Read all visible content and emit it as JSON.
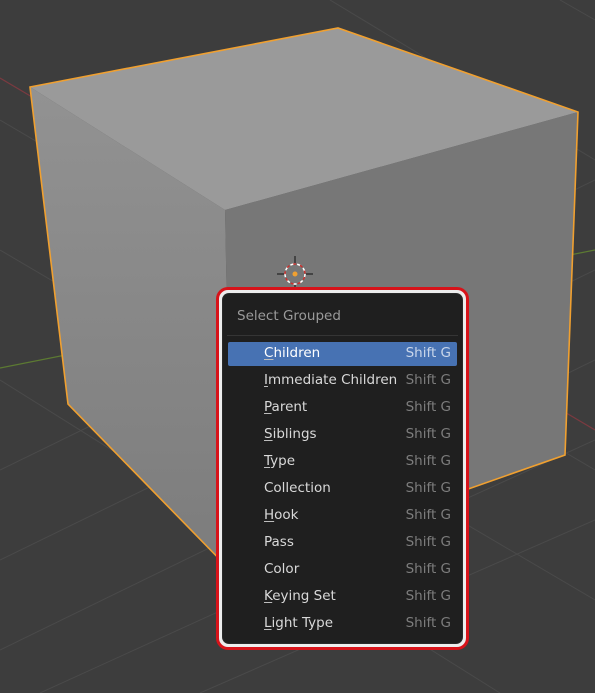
{
  "menu": {
    "title": "Select Grouped",
    "items": [
      {
        "first": "C",
        "rest": "hildren",
        "shortcut": "Shift G",
        "active": true
      },
      {
        "first": "I",
        "rest": "mmediate Children",
        "shortcut": "Shift G",
        "active": false
      },
      {
        "first": "P",
        "rest": "arent",
        "shortcut": "Shift G",
        "active": false
      },
      {
        "first": "S",
        "rest": "iblings",
        "shortcut": "Shift G",
        "active": false
      },
      {
        "first": "T",
        "rest": "ype",
        "shortcut": "Shift G",
        "active": false
      },
      {
        "first": "",
        "rest": "Collection",
        "shortcut": "Shift G",
        "active": false
      },
      {
        "first": "H",
        "rest": "ook",
        "shortcut": "Shift G",
        "active": false
      },
      {
        "first": "",
        "rest": "Pass",
        "shortcut": "Shift G",
        "active": false
      },
      {
        "first": "",
        "rest": "Color",
        "shortcut": "Shift G",
        "active": false
      },
      {
        "first": "K",
        "rest": "eying Set",
        "shortcut": "Shift G",
        "active": false
      },
      {
        "first": "L",
        "rest": "ight Type",
        "shortcut": "Shift G",
        "active": false
      }
    ]
  },
  "scene": {
    "selected_object": "cube",
    "selection_outline_color": "#f0a030",
    "highlight_ring_color": "#d7131a"
  },
  "colors": {
    "menu_background": "#1f1f1f",
    "active_item": "#4772b3",
    "viewport_background": "#3d3d3d"
  }
}
